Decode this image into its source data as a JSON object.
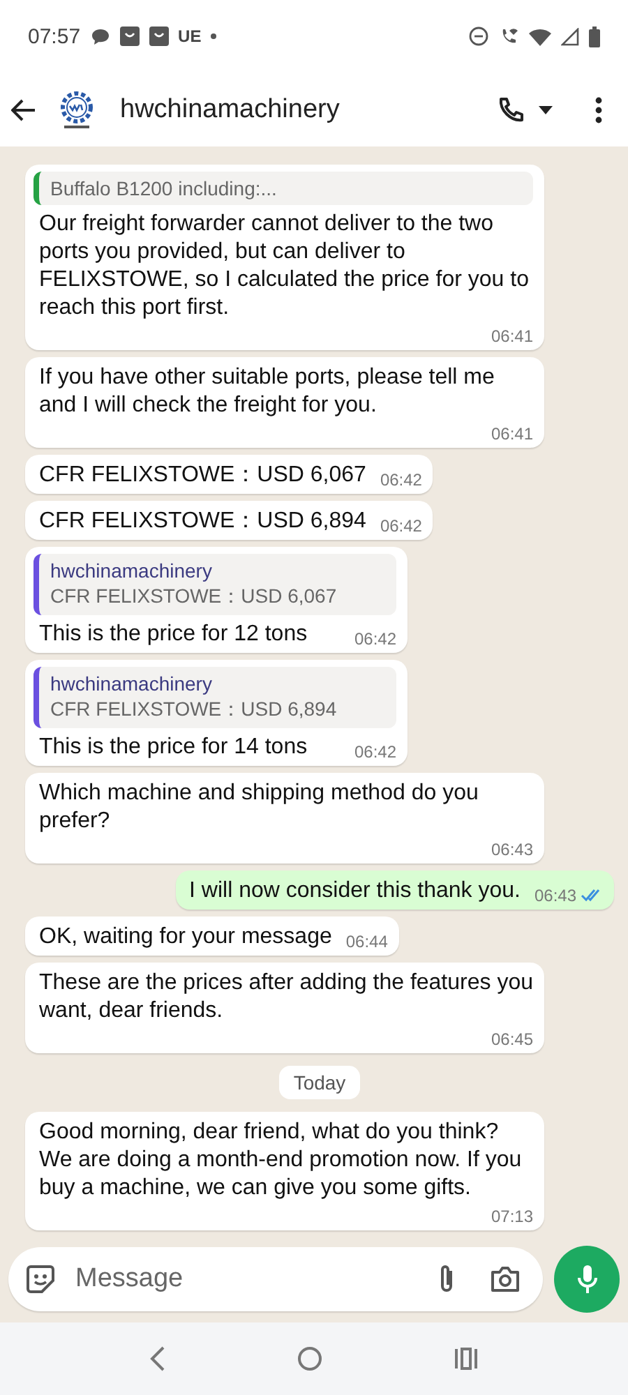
{
  "status_bar": {
    "time": "07:57",
    "carrier": "UE"
  },
  "header": {
    "contact_name": "hwchinamachinery"
  },
  "messages": [
    {
      "kind": "incoming",
      "quote": {
        "text": "Buffalo B1200 including:...",
        "color": "#25a244"
      },
      "text": "Our freight forwarder cannot deliver to the two ports you provided, but can deliver to FELIXSTOWE, so I calculated the price for you to reach this port first.",
      "time": "06:41"
    },
    {
      "kind": "incoming",
      "text": "If you have other suitable ports, please tell me and I will check the freight for you.",
      "time": "06:41"
    },
    {
      "kind": "incoming",
      "text": "CFR FELIXSTOWE：USD 6,067",
      "time": "06:42"
    },
    {
      "kind": "incoming",
      "text": "CFR FELIXSTOWE：USD 6,894",
      "time": "06:42"
    },
    {
      "kind": "incoming",
      "quote": {
        "sender": "hwchinamachinery",
        "text": "CFR FELIXSTOWE：USD 6,067",
        "color": "#6b50e0"
      },
      "text": "This is the price for 12 tons",
      "time": "06:42"
    },
    {
      "kind": "incoming",
      "quote": {
        "sender": "hwchinamachinery",
        "text": "CFR FELIXSTOWE：USD 6,894",
        "color": "#6b50e0"
      },
      "text": "This is the price for 14 tons",
      "time": "06:42"
    },
    {
      "kind": "incoming",
      "text": "Which machine and shipping method do you prefer?",
      "time": "06:43"
    },
    {
      "kind": "outgoing",
      "text": "I will now consider this thank you.",
      "time": "06:43",
      "read": true
    },
    {
      "kind": "incoming",
      "text": "OK, waiting for your message",
      "time": "06:44"
    },
    {
      "kind": "incoming",
      "text": "These are the prices after adding the features you want, dear friends.",
      "time": "06:45"
    },
    {
      "kind": "date",
      "text": "Today"
    },
    {
      "kind": "incoming",
      "text": "Good morning, dear friend, what do you think? We are doing a month-end promotion now. If you buy a machine, we can give you some gifts.",
      "time": "07:13"
    }
  ],
  "composer": {
    "placeholder": "Message"
  }
}
